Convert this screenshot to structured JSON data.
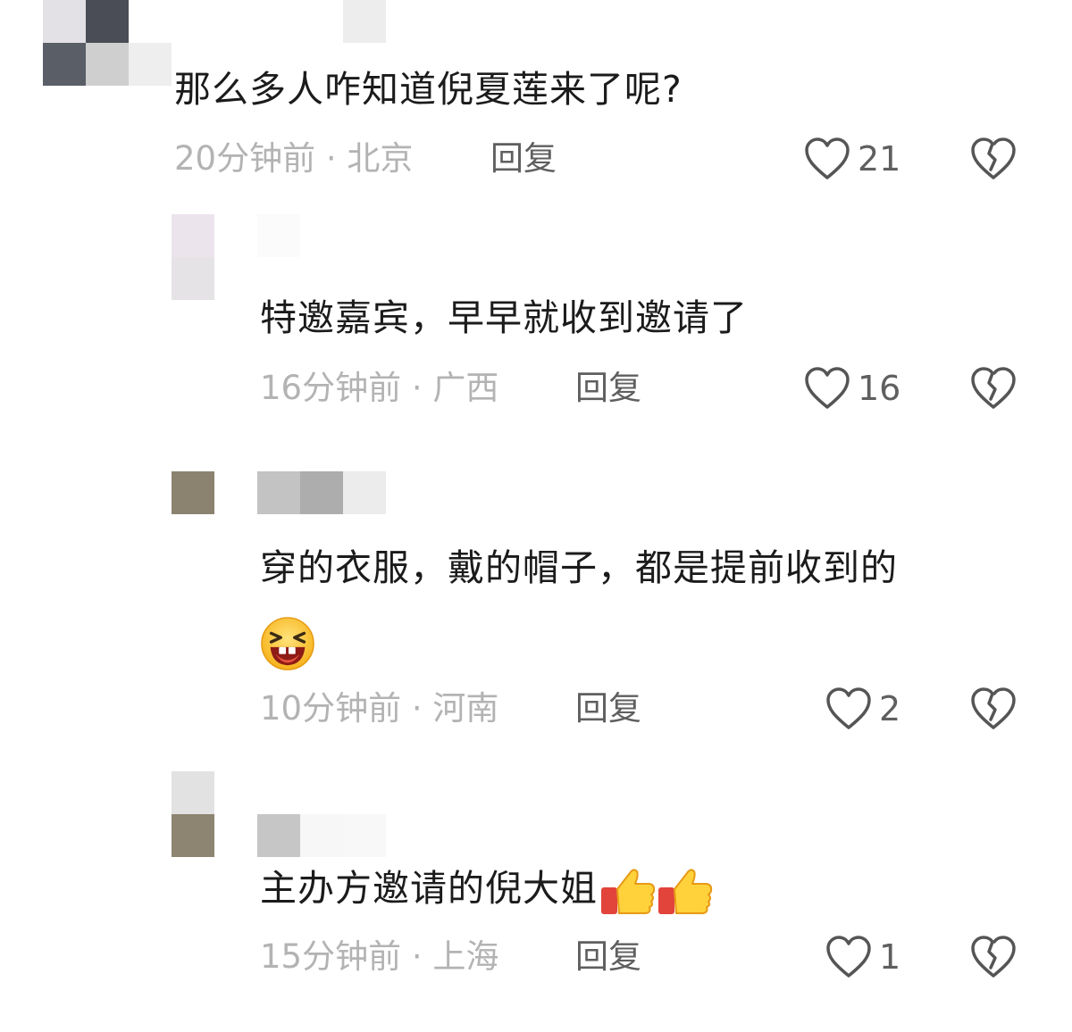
{
  "comments": [
    {
      "text": "那么多人咋知道倪夏莲来了呢?",
      "time": "20分钟前",
      "location": "北京",
      "reply_label": "回复",
      "likes": "21",
      "has_emoji": false
    },
    {
      "text": "特邀嘉宾，早早就收到邀请了",
      "time": "16分钟前",
      "location": "广西",
      "reply_label": "回复",
      "likes": "16",
      "has_emoji": false
    },
    {
      "text": "穿的衣服，戴的帽子，都是提前收到的",
      "time": "10分钟前",
      "location": "河南",
      "reply_label": "回复",
      "likes": "2",
      "emoji": "laughing-face-emoji"
    },
    {
      "text": "主办方邀请的倪大姐",
      "time": "15分钟前",
      "location": "上海",
      "reply_label": "回复",
      "likes": "1",
      "emoji": "thumbs-up-emoji"
    }
  ],
  "separator": " · ",
  "icons": {
    "like": "heart-outline-icon",
    "dislike": "broken-heart-icon"
  },
  "colors": {
    "text": "#1b1b1b",
    "meta": "#b3b3b3",
    "reply": "#5f5f5f",
    "icon": "#555555"
  }
}
